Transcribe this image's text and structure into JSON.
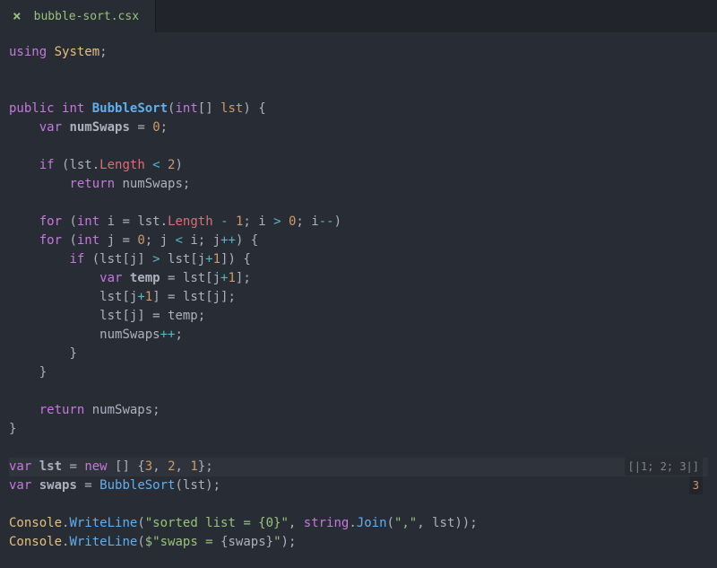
{
  "tab": {
    "label": "bubble-sort.csx"
  },
  "code": {
    "l1_using": "using",
    "l1_system": "System",
    "l1_semi": ";",
    "l3_public": "public",
    "l3_int": "int",
    "l3_func": "BubbleSort",
    "l3_paren_open": "(",
    "l3_param_type": "int",
    "l3_brackets": "[]",
    "l3_param_name": "lst",
    "l3_paren_close": ")",
    "l3_brace": " {",
    "l4_var": "var",
    "l4_name": "numSwaps",
    "l4_eq": " = ",
    "l4_val": "0",
    "l4_semi": ";",
    "l6_if": "if",
    "l6_open": " (",
    "l6_lst": "lst",
    "l6_dot": ".",
    "l6_length": "Length",
    "l6_lt": " < ",
    "l6_two": "2",
    "l6_close": ")",
    "l7_return": "return",
    "l7_name": " numSwaps;",
    "l9_for": "for",
    "l9_open": " (",
    "l9_int": "int",
    "l9_i": " i ",
    "l9_eq": "= ",
    "l9_lst": "lst",
    "l9_dot": ".",
    "l9_length": "Length",
    "l9_rest": " - ",
    "l9_one": "1",
    "l9_semi1": "; i ",
    "l9_gt": ">",
    "l9_sp0": " ",
    "l9_zero": "0",
    "l9_semi2": "; i",
    "l9_dec": "--",
    "l9_close": ")",
    "l10_for": "for",
    "l10_open": " (",
    "l10_int": "int",
    "l10_j": " j ",
    "l10_eq": "= ",
    "l10_zero": "0",
    "l10_semi1": "; j ",
    "l10_lt": "<",
    "l10_rest": " i; j",
    "l10_inc": "++",
    "l10_close": ") {",
    "l11_if": "if",
    "l11_open": " (lst[j] ",
    "l11_gt": ">",
    "l11_rest": " lst[j",
    "l11_plus": "+",
    "l11_one": "1",
    "l11_close": "]) {",
    "l12_var": "var",
    "l12_temp": " temp",
    "l12_rest": " = lst[j",
    "l12_plus": "+",
    "l12_one": "1",
    "l12_close": "];",
    "l13_a": "lst[j",
    "l13_plus": "+",
    "l13_one": "1",
    "l13_b": "] = lst[j];",
    "l14": "lst[j] = temp;",
    "l15_a": "numSwaps",
    "l15_inc": "++",
    "l15_semi": ";",
    "l16": "}",
    "l17": "}",
    "l19_return": "return",
    "l19_rest": " numSwaps;",
    "l20": "}",
    "l22_var": "var",
    "l22_lst": " lst",
    "l22_eq": " = ",
    "l22_new": "new",
    "l22_rest": " [] {",
    "l22_n3": "3",
    "l22_c1": ", ",
    "l22_n2": "2",
    "l22_c2": ", ",
    "l22_n1": "1",
    "l22_close": "};",
    "l23_var": "var",
    "l23_swaps": " swaps",
    "l23_eq": " = ",
    "l23_call": "BubbleSort",
    "l23_rest": "(lst);",
    "l25_console": "Console",
    "l25_dot": ".",
    "l25_wl": "WriteLine",
    "l25_open": "(",
    "l25_str": "\"sorted list = {0}\"",
    "l25_comma": ", ",
    "l25_string": "string",
    "l25_dot2": ".",
    "l25_join": "Join",
    "l25_open2": "(",
    "l25_comma_str": "\",\"",
    "l25_rest": ", lst));",
    "l26_console": "Console",
    "l26_dot": ".",
    "l26_wl": "WriteLine",
    "l26_open": "(",
    "l26_dollar": "$\"swaps = ",
    "l26_interp_open": "{",
    "l26_swaps": "swaps",
    "l26_interp_close": "}",
    "l26_endq": "\"",
    "l26_close": ");"
  },
  "results": {
    "lst": "[|1; 2; 3|]",
    "swaps": "3"
  }
}
